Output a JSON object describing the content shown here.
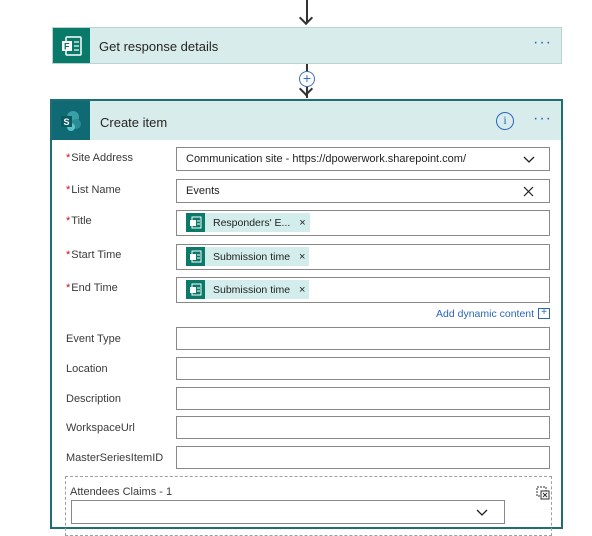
{
  "get_response": {
    "title": "Get response details",
    "more_label": "···"
  },
  "create_item": {
    "title": "Create item",
    "info_label": "i",
    "more_label": "···"
  },
  "fields": {
    "site_address": {
      "label": "Site Address",
      "required": "*",
      "value": "Communication site - https://dpowerwork.sharepoint.com/"
    },
    "list_name": {
      "label": "List Name",
      "required": "*",
      "value": "Events"
    },
    "title": {
      "label": "Title",
      "required": "*",
      "token": "Responders' E..."
    },
    "start_time": {
      "label": "Start Time",
      "required": "*",
      "token": "Submission time"
    },
    "end_time": {
      "label": "End Time",
      "required": "*",
      "token": "Submission time"
    },
    "event_type": {
      "label": "Event Type",
      "value": ""
    },
    "location": {
      "label": "Location",
      "value": ""
    },
    "description": {
      "label": "Description",
      "value": ""
    },
    "workspace_url": {
      "label": "WorkspaceUrl",
      "value": ""
    },
    "master_series_item_id": {
      "label": "MasterSeriesItemID",
      "value": ""
    }
  },
  "add_dynamic_content": {
    "label": "Add dynamic content",
    "icon_glyph": "+"
  },
  "attendees": {
    "label": "Attendees Claims - 1",
    "value": ""
  },
  "token_close_glyph": "×",
  "clear_glyph": "✕",
  "plus_glyph": "+",
  "colors": {
    "forms_green": "#097969",
    "sharepoint_teal": "#0f6a74",
    "card_header_bg": "#d9ecec",
    "card_border": "#1e6e74",
    "link_blue": "#2a66c0",
    "required_red": "#c50f1f"
  },
  "icons": {
    "forms": "forms-app-icon",
    "sharepoint": "sharepoint-app-icon",
    "token_forms": "forms-token-icon"
  }
}
